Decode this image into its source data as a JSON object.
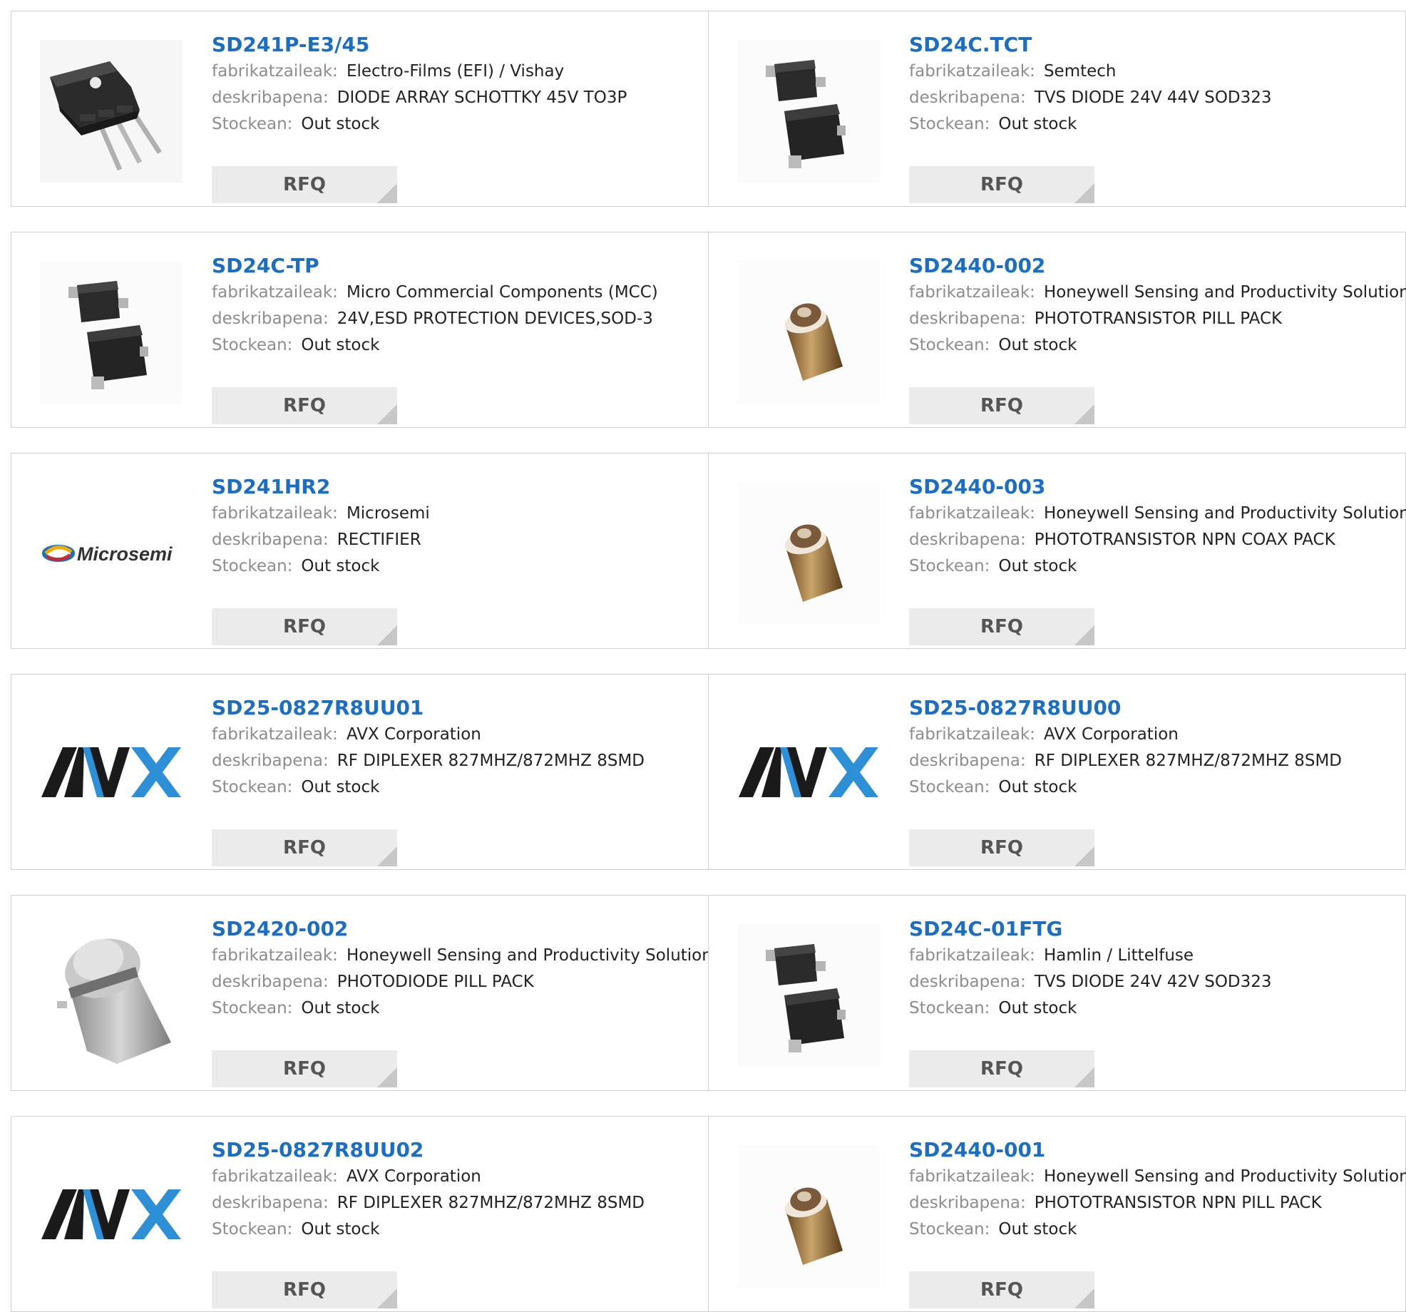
{
  "labels": {
    "manufacturer": "fabrikatzaileak:",
    "description": "deskribapena:",
    "stock": "Stockean:",
    "rfq": "RFQ"
  },
  "brand_colors": {
    "link": "#1b6ec2",
    "avx_dark": "#1a1a1a",
    "avx_blue": "#2d8fd6"
  },
  "products": [
    {
      "part": "SD241P-E3/45",
      "manufacturer": "Electro-Films (EFI) / Vishay",
      "description": "DIODE ARRAY SCHOTTKY 45V TO3P",
      "stock": "Out stock",
      "image": "to3p-package-image"
    },
    {
      "part": "SD24C.TCT",
      "manufacturer": "Semtech",
      "description": "TVS DIODE 24V 44V SOD323",
      "stock": "Out stock",
      "image": "sod323-package-image"
    },
    {
      "part": "SD24C-TP",
      "manufacturer": "Micro Commercial Components (MCC)",
      "description": "24V,ESD PROTECTION DEVICES,SOD-3",
      "stock": "Out stock",
      "image": "sod323-package-image"
    },
    {
      "part": "SD2440-002",
      "manufacturer": "Honeywell Sensing and Productivity Solutions",
      "description": "PHOTOTRANSISTOR PILL PACK",
      "stock": "Out stock",
      "image": "pill-pack-image"
    },
    {
      "part": "SD241HR2",
      "manufacturer": "Microsemi",
      "description": "RECTIFIER",
      "stock": "Out stock",
      "image": "microsemi-logo"
    },
    {
      "part": "SD2440-003",
      "manufacturer": "Honeywell Sensing and Productivity Solutions",
      "description": "PHOTOTRANSISTOR NPN COAX PACK",
      "stock": "Out stock",
      "image": "pill-pack-image"
    },
    {
      "part": "SD25-0827R8UU01",
      "manufacturer": "AVX Corporation",
      "description": "RF DIPLEXER 827MHZ/872MHZ 8SMD",
      "stock": "Out stock",
      "image": "avx-logo"
    },
    {
      "part": "SD25-0827R8UU00",
      "manufacturer": "AVX Corporation",
      "description": "RF DIPLEXER 827MHZ/872MHZ 8SMD",
      "stock": "Out stock",
      "image": "avx-logo"
    },
    {
      "part": "SD2420-002",
      "manufacturer": "Honeywell Sensing and Productivity Solutions",
      "description": "PHOTODIODE PILL PACK",
      "stock": "Out stock",
      "image": "photodiode-image"
    },
    {
      "part": "SD24C-01FTG",
      "manufacturer": "Hamlin / Littelfuse",
      "description": "TVS DIODE 24V 42V SOD323",
      "stock": "Out stock",
      "image": "sod323-package-image"
    },
    {
      "part": "SD25-0827R8UU02",
      "manufacturer": "AVX Corporation",
      "description": "RF DIPLEXER 827MHZ/872MHZ 8SMD",
      "stock": "Out stock",
      "image": "avx-logo"
    },
    {
      "part": "SD2440-001",
      "manufacturer": "Honeywell Sensing and Productivity Solutions",
      "description": "PHOTOTRANSISTOR NPN PILL PACK",
      "stock": "Out stock",
      "image": "pill-pack-image"
    }
  ],
  "logos": {
    "microsemi": "Microsemi",
    "avx": "AVX"
  }
}
